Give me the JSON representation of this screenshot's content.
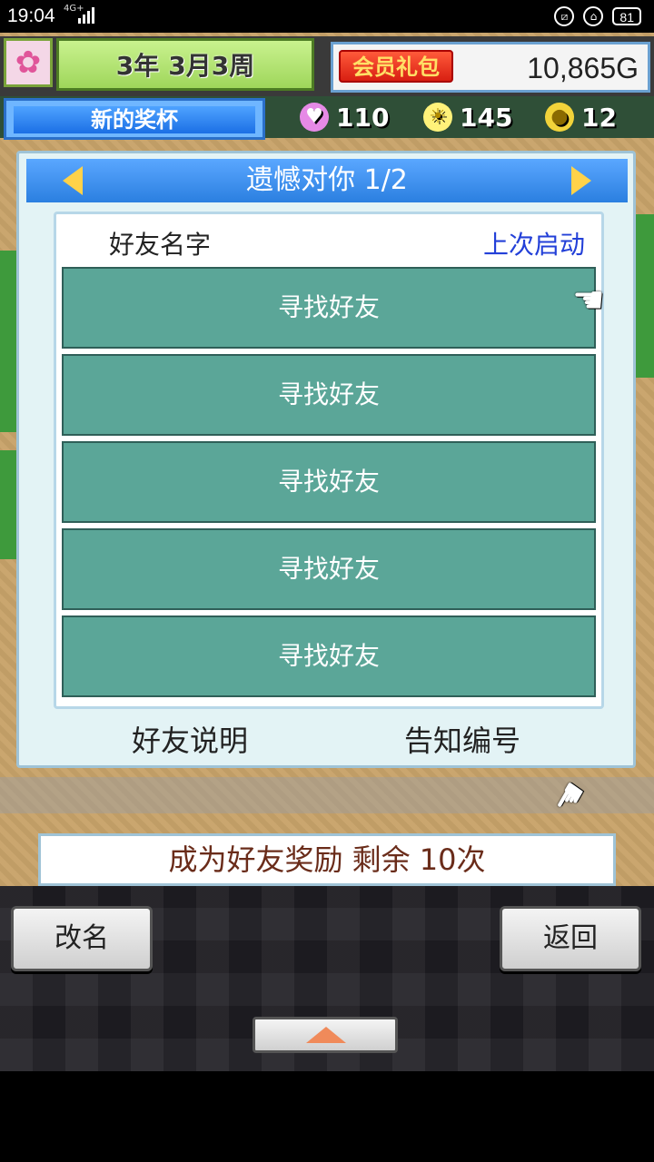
{
  "status_bar": {
    "time": "19:04",
    "network": "4G+",
    "battery": "81"
  },
  "hud": {
    "year": "3年",
    "month_week": "3月3周",
    "vip_label": "会员礼包",
    "gold": "10,865G",
    "trophy_tab": "新的奖杯",
    "hearts": "110",
    "ideas": "145",
    "coins": "12"
  },
  "dialog": {
    "title": "遗憾对你 1/2",
    "col_name": "好友名字",
    "col_last": "上次启动",
    "rows": [
      "寻找好友",
      "寻找好友",
      "寻找好友",
      "寻找好友",
      "寻找好友"
    ],
    "footer_left": "好友说明",
    "footer_right": "告知编号"
  },
  "reward_text": "成为好友奖励 剩余 10次",
  "buttons": {
    "rename": "改名",
    "back": "返回"
  },
  "colors": {
    "row": "#5ba698",
    "title_bar": "#2b7fe0",
    "link_blue": "#2340d8"
  }
}
